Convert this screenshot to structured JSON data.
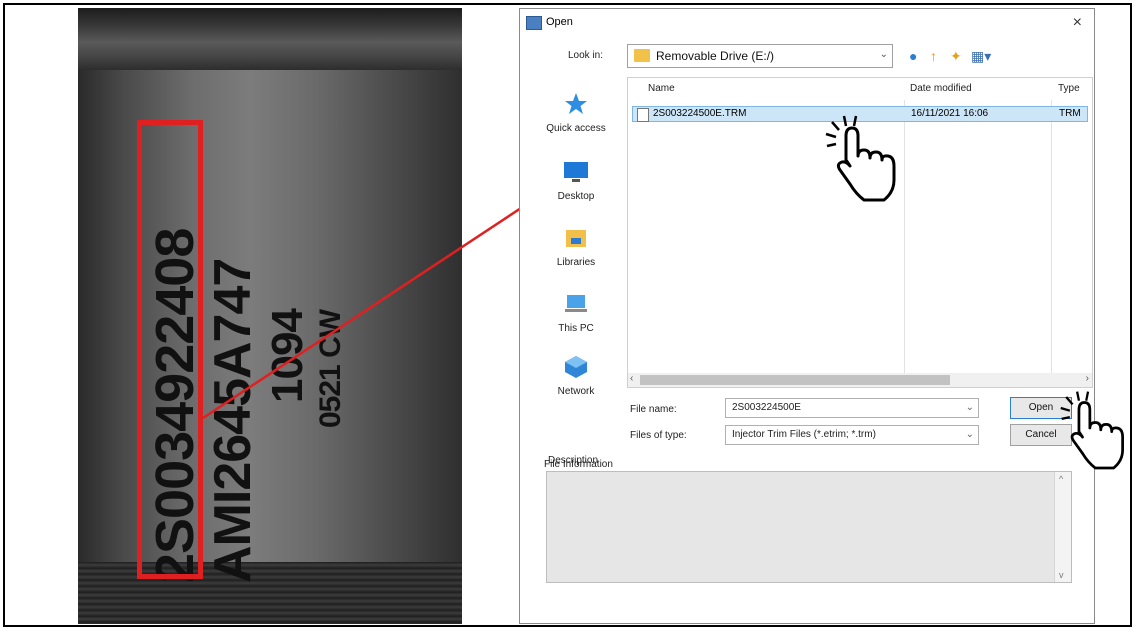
{
  "photo": {
    "line1": "2S0034922408",
    "line2": "AMI2645A747",
    "line3": "1094",
    "line4": "0521 CW"
  },
  "dialog": {
    "title": "Open",
    "close": "×",
    "look_in_label": "Look in:",
    "look_in_value": "Removable Drive (E:/)",
    "places": [
      "Quick access",
      "Desktop",
      "Libraries",
      "This PC",
      "Network"
    ],
    "columns": {
      "name": "Name",
      "date": "Date modified",
      "type": "Type"
    },
    "files": [
      {
        "name": "2S003224500E.TRM",
        "date": "16/11/2021 16:06",
        "type": "TRM"
      }
    ],
    "file_name_label": "File name:",
    "file_name_value": "2S003224500E",
    "files_of_type_label": "Files of type:",
    "files_of_type_value": "Injector Trim Files (*.etrim; *.trm)",
    "open_button": "Open",
    "cancel_button": "Cancel",
    "file_info_label": "File Information",
    "description_label": "Description"
  },
  "colors": {
    "highlight_box": "#e02020",
    "arrow": "#e02020",
    "selection": "#cde6f7"
  }
}
